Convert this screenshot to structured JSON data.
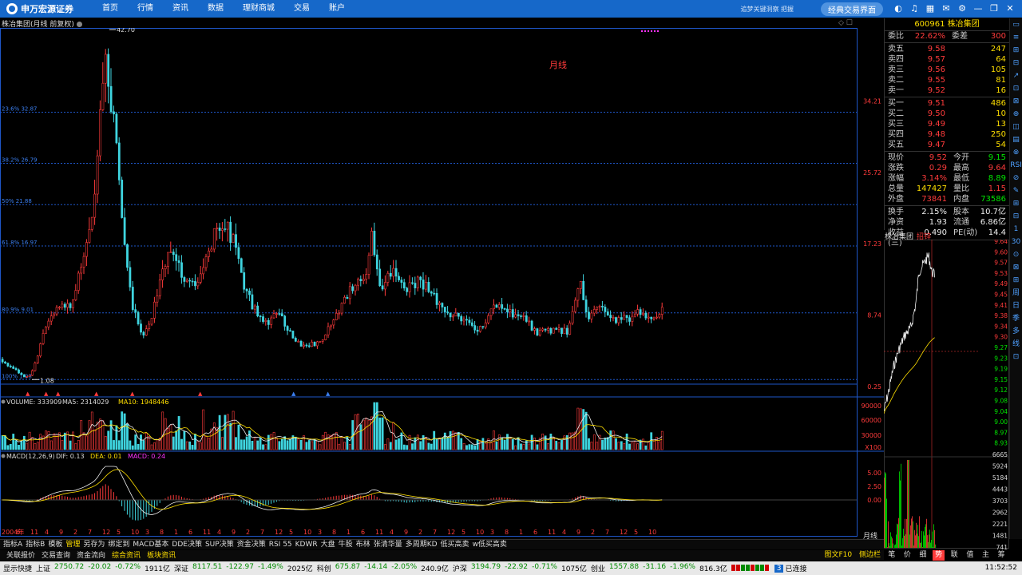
{
  "topbar": {
    "brand": "申万宏源证券",
    "nav": [
      "首页",
      "行情",
      "资讯",
      "数据",
      "理财商城",
      "交易",
      "账户"
    ],
    "slogan": "追梦关键洞察 把握",
    "classic_button": "经典交易界面",
    "icons": [
      "app-icon",
      "headset-icon",
      "calculator-icon",
      "message-icon",
      "settings-icon",
      "minimize-icon",
      "restore-icon",
      "close-icon"
    ]
  },
  "chart": {
    "title": "株冶集团(月线 前复权)",
    "period_note": "月线",
    "y_ticks": [
      "34.21",
      "25.72",
      "17.23",
      "8.74",
      "0.25"
    ],
    "fib_lines": [
      {
        "label": "23.6% 32.87",
        "value": 32.87
      },
      {
        "label": "38.2% 26.79",
        "value": 26.79
      },
      {
        "label": "50% 21.88",
        "value": 21.88
      },
      {
        "label": "61.8% 16.97",
        "value": 16.97
      },
      {
        "label": "80.9% 9.01",
        "value": 9.01
      },
      {
        "label": "100% 1.08",
        "value": 1.08
      }
    ],
    "high_label": "42.70",
    "low_label": "1.08",
    "high_value": 42.7,
    "low_value": 1.08,
    "x_labels": [
      "2004年",
      "6",
      "11",
      "4",
      "9",
      "2",
      "7",
      "12",
      "5",
      "10",
      "3",
      "8",
      "1",
      "6",
      "11",
      "4",
      "9",
      "2",
      "7",
      "12",
      "5",
      "10",
      "3",
      "8",
      "1",
      "6",
      "11",
      "4",
      "9",
      "2",
      "7",
      "12",
      "5",
      "10",
      "3",
      "8",
      "1",
      "6",
      "11",
      "4",
      "9",
      "2",
      "7",
      "12",
      "5",
      "10"
    ],
    "x_axis_period": "月线",
    "zoom_controls": [
      "+",
      "−"
    ]
  },
  "volume": {
    "label": "VOLUME: 333909",
    "ma5": "MA5: 2314029",
    "ma10": "MA10: 1948446",
    "ticks": [
      "90000",
      "60000",
      "30000"
    ],
    "unit": "X100"
  },
  "macd": {
    "label": "MACD(12,26,9)",
    "dif": "DIF: 0.13",
    "dea": "DEA: 0.01",
    "macd": "MACD: 0.24",
    "ticks": [
      "5.00",
      "2.50",
      "0.00"
    ]
  },
  "quote": {
    "code": "600961",
    "name": "株冶集团",
    "ratio_label": "委比",
    "ratio": "22.62%",
    "diff_label": "委差",
    "diff": "300",
    "asks": [
      {
        "label": "卖五",
        "price": "9.58",
        "vol": "247"
      },
      {
        "label": "卖四",
        "price": "9.57",
        "vol": "64"
      },
      {
        "label": "卖三",
        "price": "9.56",
        "vol": "105"
      },
      {
        "label": "卖二",
        "price": "9.55",
        "vol": "81"
      },
      {
        "label": "卖一",
        "price": "9.52",
        "vol": "16"
      }
    ],
    "bids": [
      {
        "label": "买一",
        "price": "9.51",
        "vol": "486"
      },
      {
        "label": "买二",
        "price": "9.50",
        "vol": "10"
      },
      {
        "label": "买三",
        "price": "9.49",
        "vol": "13"
      },
      {
        "label": "买四",
        "price": "9.48",
        "vol": "250"
      },
      {
        "label": "买五",
        "price": "9.47",
        "vol": "54"
      }
    ],
    "stats": [
      {
        "l1": "现价",
        "v1": "9.52",
        "c1": "red",
        "l2": "今开",
        "v2": "9.15",
        "c2": "green"
      },
      {
        "l1": "涨跌",
        "v1": "0.29",
        "c1": "red",
        "l2": "最高",
        "v2": "9.64",
        "c2": "red"
      },
      {
        "l1": "涨幅",
        "v1": "3.14%",
        "c1": "red",
        "l2": "最低",
        "v2": "8.89",
        "c2": "green"
      },
      {
        "l1": "总量",
        "v1": "147427",
        "c1": "yellow",
        "l2": "量比",
        "v2": "1.15",
        "c2": "red"
      },
      {
        "l1": "外盘",
        "v1": "73841",
        "c1": "red",
        "l2": "内盘",
        "v2": "73586",
        "c2": "green"
      }
    ],
    "stats2": [
      {
        "l1": "换手",
        "v1": "2.15%",
        "l2": "股本",
        "v2": "10.7亿"
      },
      {
        "l1": "净资",
        "v1": "1.93",
        "l2": "流通",
        "v2": "6.86亿"
      },
      {
        "l1": "收益(三)",
        "v1": "0.490",
        "l2": "PE(动)",
        "v2": "14.4"
      }
    ]
  },
  "intraday": {
    "title": "株冶集团",
    "subtitle": "招锌",
    "price_ticks": [
      "9.64",
      "9.60",
      "9.57",
      "9.53",
      "9.49",
      "9.45",
      "9.41",
      "9.38",
      "9.34",
      "9.30",
      "9.27",
      "9.23",
      "9.19",
      "9.15",
      "9.12",
      "9.08",
      "9.04",
      "9.00",
      "8.97",
      "8.93"
    ],
    "vol_ticks": [
      "6665",
      "5924",
      "5184",
      "4443",
      "3703",
      "2962",
      "2221",
      "1481",
      "741"
    ]
  },
  "side_toolbar": [
    "▭",
    "≡",
    "⊞",
    "⊟",
    "↗",
    "⊡",
    "⊠",
    "⊕",
    "◫",
    "▤",
    "⊗",
    "RSI",
    "⊘",
    "✎",
    "⊞",
    "⊟",
    "1",
    "30",
    "⊙",
    "⊠",
    "⊞",
    "周",
    "日",
    "季",
    "多",
    "线",
    "⊡"
  ],
  "indicator_tabs": [
    "指标A",
    "指标B",
    "模板",
    "管理",
    "另存为",
    "绑定到",
    "MACD基本",
    "DDE决策",
    "SUP决策",
    "资金决策",
    "RSI 55",
    "KDWR",
    "大盘",
    "牛股",
    "布林",
    "张清华量",
    "多周期KD",
    "低买高卖",
    "w低买高卖"
  ],
  "info_tabs": [
    "关联报价",
    "交易查询",
    "资金流向",
    "综合资讯",
    "板块资讯"
  ],
  "info_right": [
    "图文F10",
    "侧边栏"
  ],
  "right_bottom_tabs": [
    "笔",
    "价",
    "细",
    "势",
    "联",
    "值",
    "主",
    "筹"
  ],
  "statusbar": {
    "items": [
      {
        "t": "显示快捷",
        "c": ""
      },
      {
        "t": "上证",
        "c": ""
      },
      {
        "t": "2750.72",
        "c": "sb-green"
      },
      {
        "t": "-20.02",
        "c": "sb-green"
      },
      {
        "t": "-0.72%",
        "c": "sb-green"
      },
      {
        "t": "1911亿",
        "c": ""
      },
      {
        "t": "深证",
        "c": ""
      },
      {
        "t": "8117.51",
        "c": "sb-green"
      },
      {
        "t": "-122.97",
        "c": "sb-green"
      },
      {
        "t": "-1.49%",
        "c": "sb-green"
      },
      {
        "t": "2025亿",
        "c": ""
      },
      {
        "t": "科创",
        "c": ""
      },
      {
        "t": "675.87",
        "c": "sb-green"
      },
      {
        "t": "-14.14",
        "c": "sb-green"
      },
      {
        "t": "-2.05%",
        "c": "sb-green"
      },
      {
        "t": "240.9亿",
        "c": ""
      },
      {
        "t": "沪深",
        "c": ""
      },
      {
        "t": "3194.79",
        "c": "sb-green"
      },
      {
        "t": "-22.92",
        "c": "sb-green"
      },
      {
        "t": "-0.71%",
        "c": "sb-green"
      },
      {
        "t": "1075亿",
        "c": ""
      },
      {
        "t": "创业",
        "c": ""
      },
      {
        "t": "1557.88",
        "c": "sb-green"
      },
      {
        "t": "-31.16",
        "c": "sb-green"
      },
      {
        "t": "-1.96%",
        "c": "sb-green"
      },
      {
        "t": "816.3亿",
        "c": ""
      }
    ],
    "connect_num": "3",
    "connect_text": "已连接",
    "clock": "11:52:52"
  },
  "colors": {
    "up": "#ff3b3b",
    "down": "#3fd5e0",
    "yellow": "#ffdf00",
    "grid": "#1e56c8"
  }
}
